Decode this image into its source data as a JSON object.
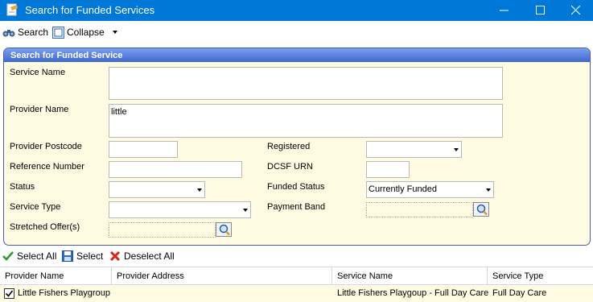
{
  "window": {
    "title": "Search for Funded Services"
  },
  "toolbar": {
    "search_label": "Search",
    "collapse_label": "Collapse"
  },
  "panel": {
    "title": "Search for Funded Service",
    "fields": {
      "service_name": {
        "label": "Service Name",
        "value": ""
      },
      "provider_name": {
        "label": "Provider Name",
        "value": "little"
      },
      "provider_postcode": {
        "label": "Provider Postcode",
        "value": ""
      },
      "registered": {
        "label": "Registered",
        "value": ""
      },
      "reference_number": {
        "label": "Reference Number",
        "value": ""
      },
      "dcsf_urn": {
        "label": "DCSF URN",
        "value": ""
      },
      "status": {
        "label": "Status",
        "value": ""
      },
      "funded_status": {
        "label": "Funded Status",
        "value": "Currently Funded"
      },
      "service_type": {
        "label": "Service Type",
        "value": ""
      },
      "payment_band": {
        "label": "Payment Band",
        "value": ""
      },
      "stretched_offers": {
        "label": "Stretched Offer(s)",
        "value": ""
      }
    }
  },
  "actions": {
    "select_all": "Select All",
    "select": "Select",
    "deselect_all": "Deselect All"
  },
  "grid": {
    "columns": [
      "Provider Name",
      "Provider Address",
      "Service Name",
      "Service Type"
    ],
    "rows": [
      {
        "checked": true,
        "provider_name": "Little Fishers Playgroup",
        "provider_address": "",
        "service_name": "Little Fishers Playgoup - Full Day Care",
        "service_type": "Full Day Care"
      }
    ]
  },
  "colors": {
    "titlebar": "#0078d7",
    "panel_bg": "#fffbe3",
    "panel_header": "#3e67cf"
  }
}
